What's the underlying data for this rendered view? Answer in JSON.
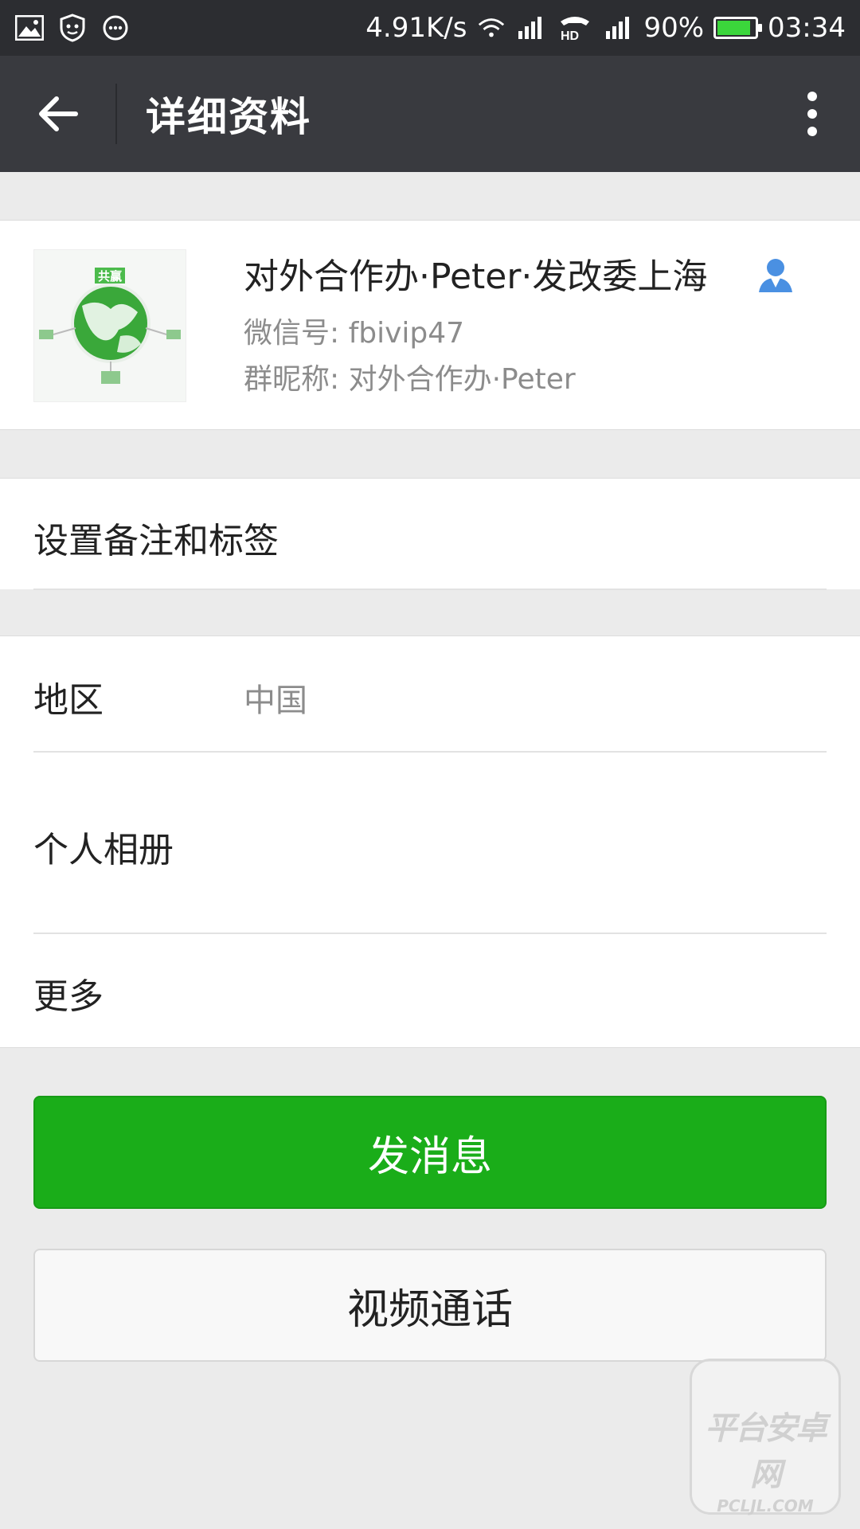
{
  "status_bar": {
    "left_icons": [
      "image-icon",
      "shield-icon",
      "chat-bubble-icon"
    ],
    "net_speed": "4.91K/s",
    "battery": "90%",
    "battery_level": 0.9,
    "time": "03:34",
    "hd_label": "HD"
  },
  "top_bar": {
    "title": "详细资料"
  },
  "profile": {
    "name": "对外合作办·Peter·发改委上海",
    "wechat_id": "微信号: fbivip47",
    "nickname": "群昵称: 对外合作办·Peter",
    "avatar_text": "共赢"
  },
  "remarks": {
    "label": "设置备注和标签"
  },
  "info": {
    "region_label": "地区",
    "region_value": "中国",
    "album_label": "个人相册",
    "more_label": "更多"
  },
  "buttons": {
    "send_message": "发消息",
    "video_call": "视频通话"
  },
  "watermark": {
    "main": "平台安卓网",
    "sub": "PCLJL.COM"
  },
  "colors": {
    "accent_green": "#1aad19",
    "top_bar": "#393a3f",
    "status_bar": "#2c2d31",
    "contact_icon": "#4a90e2"
  }
}
